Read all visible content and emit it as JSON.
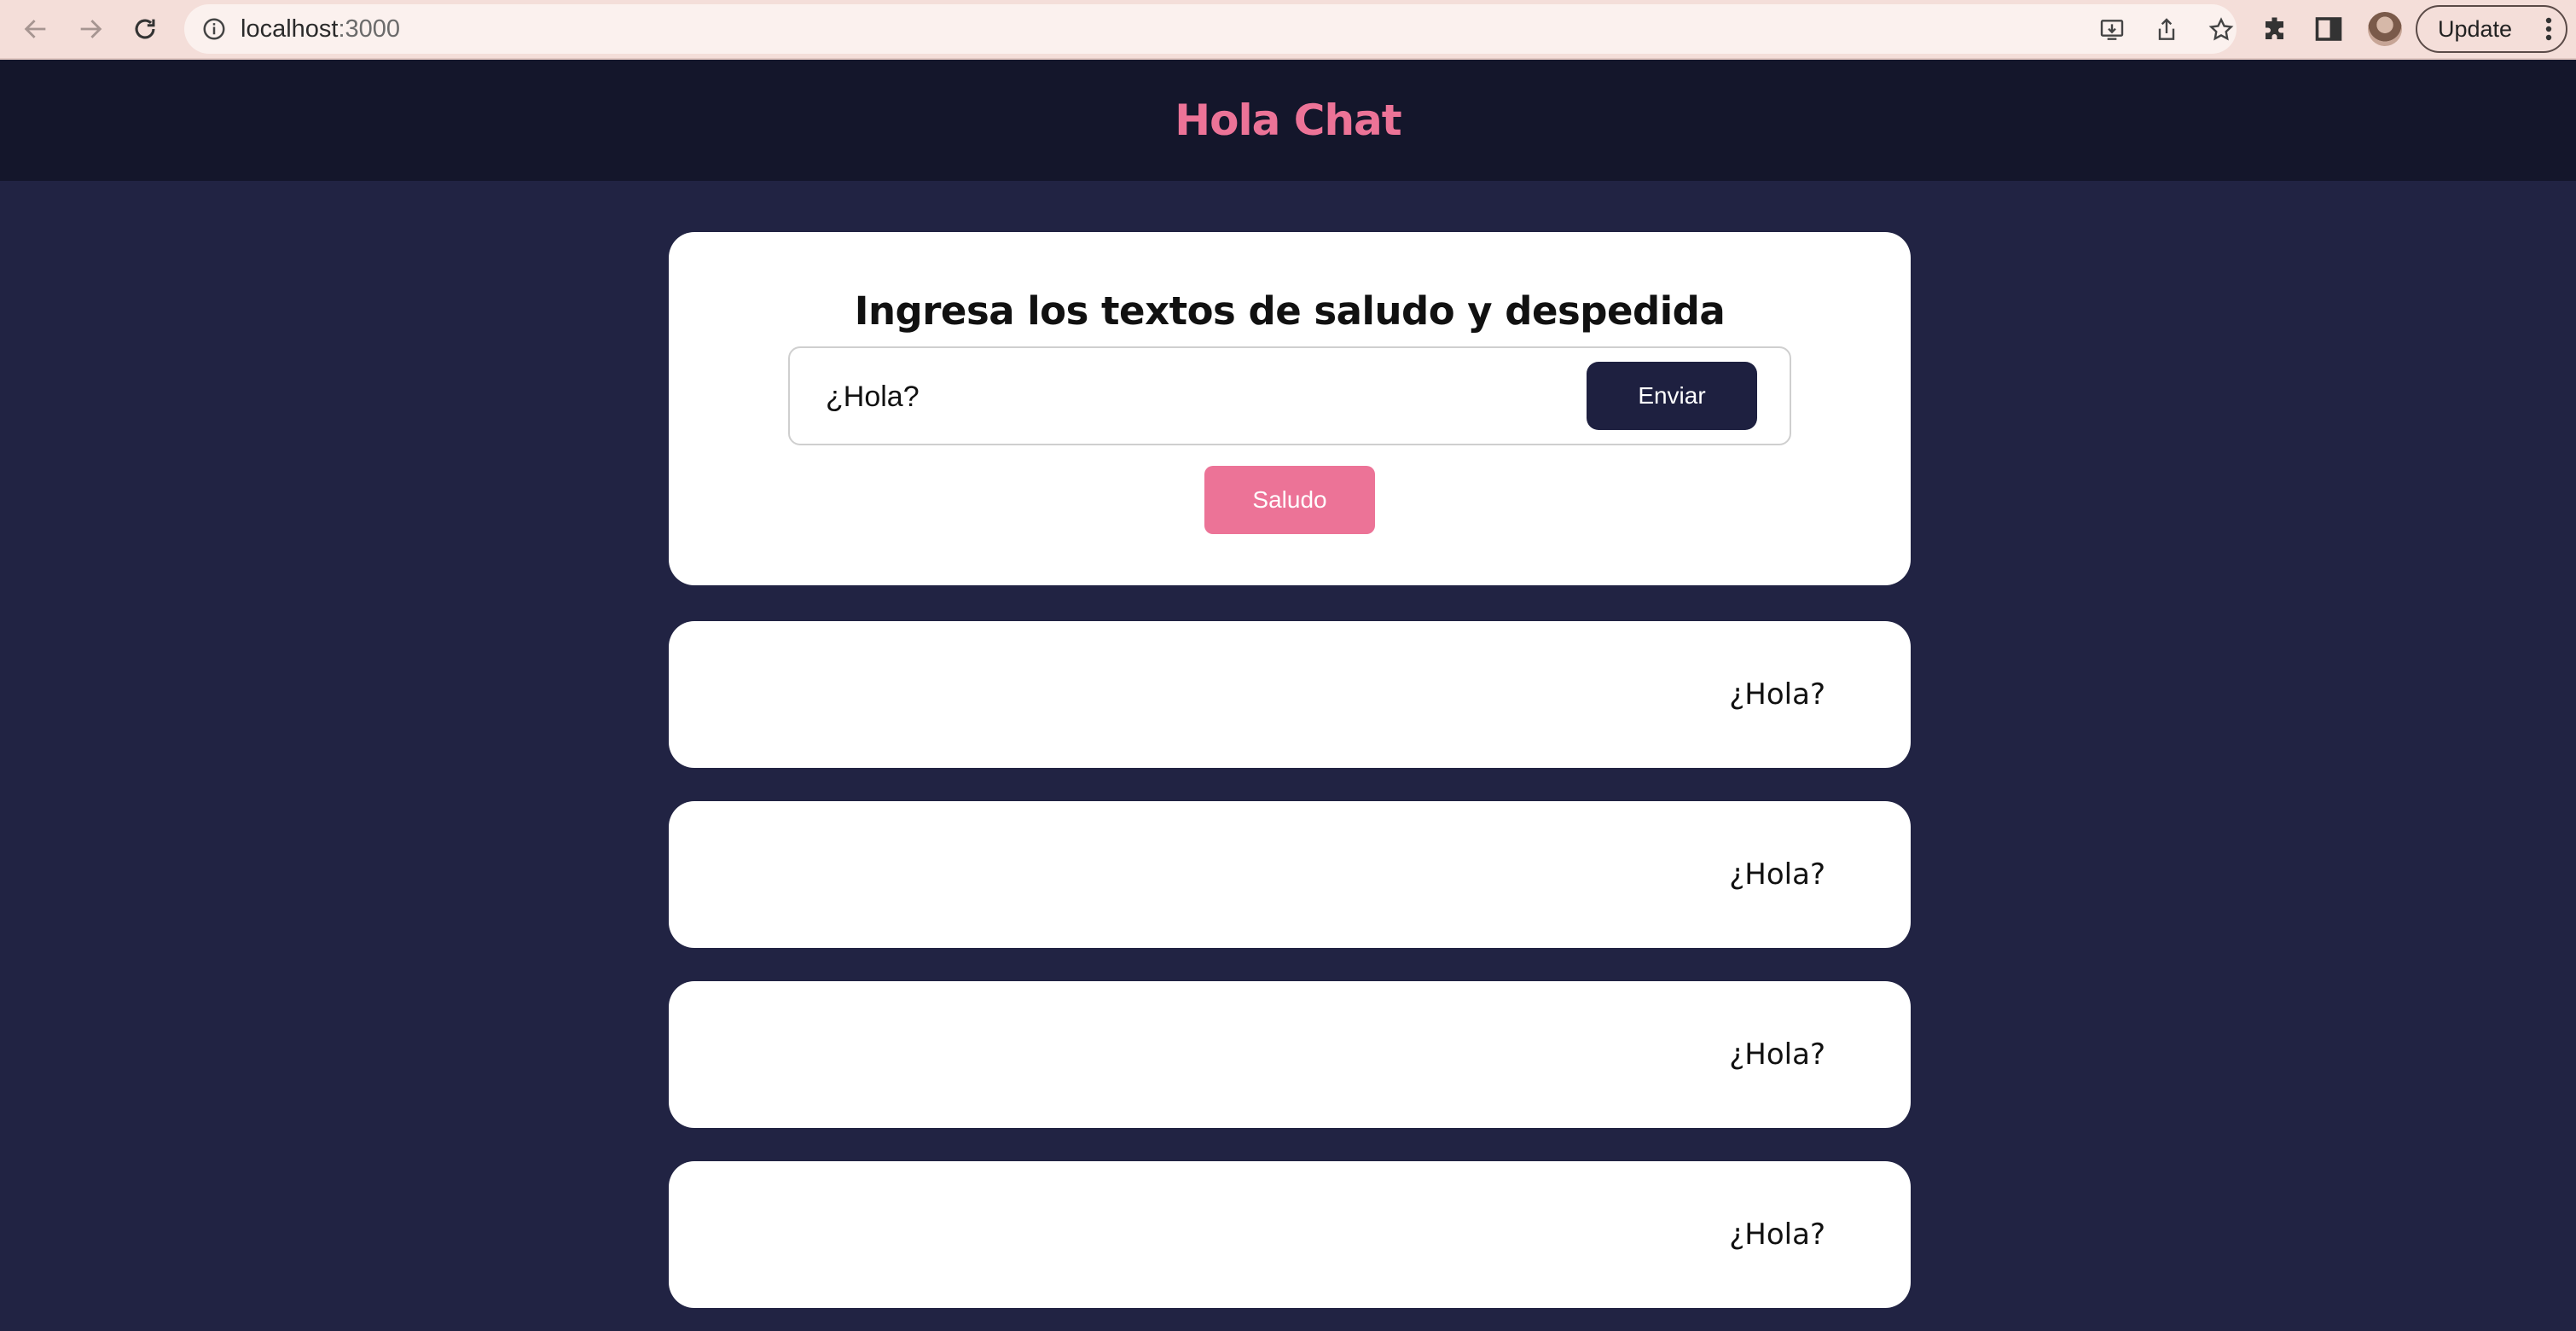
{
  "browser": {
    "url_host": "localhost",
    "url_port": ":3000",
    "update_label": "Update",
    "icons": [
      "back-arrow-icon",
      "forward-arrow-icon",
      "reload-icon",
      "info-icon",
      "install-icon",
      "share-icon",
      "star-icon",
      "extensions-icon",
      "side-panel-icon",
      "more-vertical-icon"
    ]
  },
  "app": {
    "title": "Hola Chat",
    "accent": "#ec7397",
    "header_bg": "#14162b",
    "page_bg": "#212343"
  },
  "form": {
    "heading": "Ingresa los textos de saludo y despedida",
    "input_value": "¿Hola?",
    "send_label": "Enviar",
    "greet_label": "Saludo"
  },
  "messages": [
    {
      "text": "¿Hola?"
    },
    {
      "text": "¿Hola?"
    },
    {
      "text": "¿Hola?"
    },
    {
      "text": "¿Hola?"
    }
  ]
}
